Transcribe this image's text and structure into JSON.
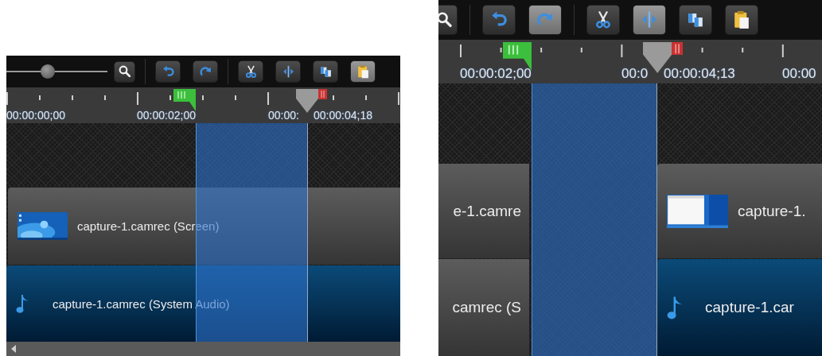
{
  "panels": [
    {
      "toolbar": {
        "zoom_slider": {
          "level": 0.41
        },
        "buttons": [
          {
            "kind": "zoom",
            "highlighted": false
          },
          {
            "kind": "undo",
            "highlighted": false
          },
          {
            "kind": "redo",
            "highlighted": false
          },
          {
            "kind": "cut",
            "highlighted": false
          },
          {
            "kind": "split",
            "highlighted": false
          },
          {
            "kind": "copy",
            "highlighted": false
          },
          {
            "kind": "paste",
            "highlighted": true
          }
        ]
      },
      "ruler": {
        "labels": [
          "00:00:00;00",
          "00:00:02;00",
          "00:00:"
        ],
        "playhead_time": "00:00:04;18"
      },
      "tracks": [
        {
          "kind": "video",
          "clips": [
            {
              "label": "capture-1.camrec (Screen)",
              "thumbnail": true,
              "selected": false
            }
          ]
        },
        {
          "kind": "audio",
          "clips": [
            {
              "label": "capture-1.camrec (System Audio)",
              "note_icon": true,
              "selected": true
            }
          ]
        }
      ],
      "scrollbar": true
    },
    {
      "toolbar": {
        "buttons": [
          {
            "kind": "zoom",
            "highlighted": false
          },
          {
            "kind": "undo",
            "highlighted": false
          },
          {
            "kind": "redo",
            "highlighted": true
          },
          {
            "kind": "cut",
            "highlighted": false
          },
          {
            "kind": "split",
            "highlighted": true
          },
          {
            "kind": "copy",
            "highlighted": false
          },
          {
            "kind": "paste",
            "highlighted": false
          }
        ]
      },
      "ruler": {
        "labels": [
          "00:00:02;00",
          "00:0",
          "00:00"
        ],
        "playhead_time": "00:00:04;13"
      },
      "tracks": [
        {
          "kind": "video",
          "clips": [
            {
              "label": "e-1.camre",
              "selected": false
            },
            {
              "label": "capture-1.",
              "thumbnail": true,
              "selected": false
            }
          ]
        },
        {
          "kind": "audio",
          "clips": [
            {
              "label": "camrec (S",
              "selected": false
            },
            {
              "label": "capture-1.car",
              "note_icon": true,
              "selected": true
            }
          ]
        }
      ]
    }
  ]
}
